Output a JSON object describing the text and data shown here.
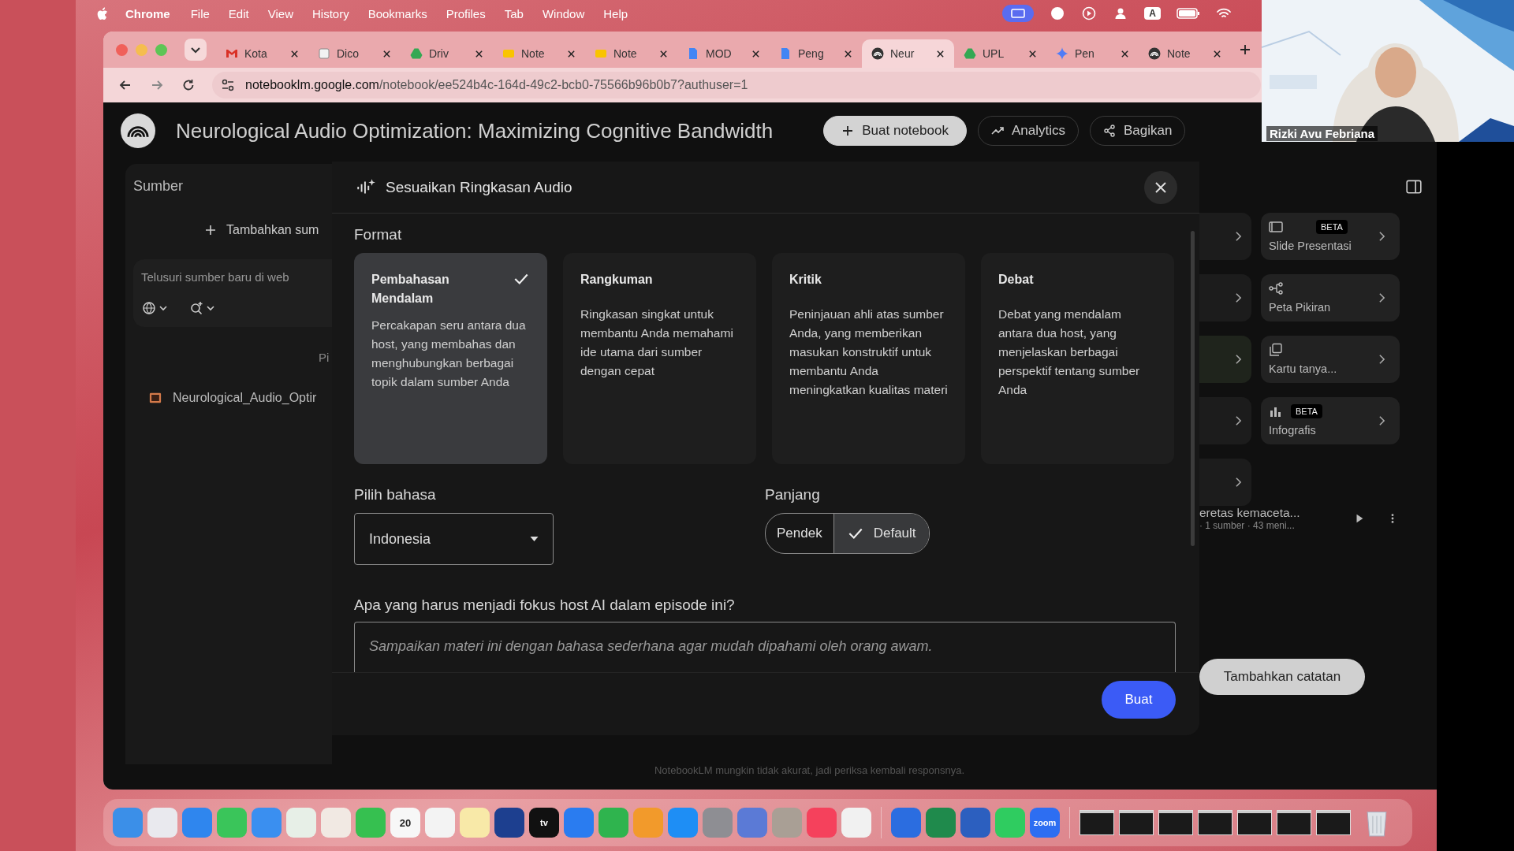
{
  "menu_bar": {
    "app": "Chrome",
    "menus": [
      "File",
      "Edit",
      "View",
      "History",
      "Bookmarks",
      "Profiles",
      "Tab",
      "Window",
      "Help"
    ],
    "input_source": "A"
  },
  "browser": {
    "tabs": [
      {
        "label": "Kota",
        "selected": false
      },
      {
        "label": "Dico",
        "selected": false
      },
      {
        "label": "Driv",
        "selected": false
      },
      {
        "label": "Note",
        "selected": false
      },
      {
        "label": "Note",
        "selected": false
      },
      {
        "label": "MOD",
        "selected": false
      },
      {
        "label": "Peng",
        "selected": false
      },
      {
        "label": "Neur",
        "selected": true
      },
      {
        "label": "UPL",
        "selected": false
      },
      {
        "label": "Pen",
        "selected": false
      },
      {
        "label": "Note",
        "selected": false
      }
    ],
    "url_host": "notebooklm.google.com",
    "url_path": "/notebook/ee524b4c-164d-49c2-bcb0-75566b96b0b7?authuser=1"
  },
  "notebook": {
    "title": "Neurological Audio Optimization: Maximizing Cognitive Bandwidth",
    "actions": [
      {
        "label": "Buat notebook",
        "kind": "create"
      },
      {
        "label": "Analytics",
        "kind": "analytics"
      },
      {
        "label": "Bagikan",
        "kind": "share"
      }
    ]
  },
  "sources": {
    "title": "Sumber",
    "add_label": "Tambahkan sum",
    "search_placeholder": "Telusuri sumber baru di web",
    "select_all": "Pi",
    "items": [
      {
        "name": "Neurological_Audio_Optir"
      }
    ]
  },
  "dialog": {
    "title": "Sesuaikan Ringkasan Audio",
    "format_label": "Format",
    "formats": [
      {
        "title": "Pembahasan Mendalam",
        "description": "Percakapan seru antara dua host, yang membahas dan menghubungkan berbagai topik dalam sumber Anda",
        "selected": true
      },
      {
        "title": "Rangkuman",
        "description": "Ringkasan singkat untuk membantu Anda memahami ide utama dari sumber dengan cepat",
        "selected": false
      },
      {
        "title": "Kritik",
        "description": "Peninjauan ahli atas sumber Anda, yang memberikan masukan konstruktif untuk membantu Anda meningkatkan kualitas materi",
        "selected": false
      },
      {
        "title": "Debat",
        "description": "Debat yang mendalam antara dua host, yang menjelaskan berbagai perspektif tentang sumber Anda",
        "selected": false
      }
    ],
    "language_label": "Pilih bahasa",
    "language": "Indonesia",
    "length_label": "Panjang",
    "lengths": [
      {
        "label": "Pendek",
        "selected": false
      },
      {
        "label": "Default",
        "selected": true
      }
    ],
    "focus_label": "Apa yang harus menjadi fokus host AI dalam episode ini?",
    "focus_placeholder": "Sampaikan materi ini dengan bahasa sederhana agar mudah dipahami oleh orang awam.",
    "submit": "Buat"
  },
  "studio": {
    "cards": [
      {
        "label": "Slide Presentasi",
        "badge": "BETA"
      },
      {
        "label": "Peta Pikiran"
      },
      {
        "label": "Kartu tanya..."
      },
      {
        "label": "Infografis",
        "badge": "BETA"
      }
    ],
    "audio_item": {
      "title": "eretas kemaceta...",
      "meta": "· 1 sumber · 43 meni..."
    },
    "add_note": "Tambahkan catatan"
  },
  "footer_note": "NotebookLM mungkin tidak akurat, jadi periksa kembali responsnya.",
  "dock": [
    {
      "kind": "app",
      "color": "#3b8fe8"
    },
    {
      "kind": "app",
      "color": "#e9e9ee"
    },
    {
      "kind": "app",
      "color": "#2f86ee"
    },
    {
      "kind": "app",
      "color": "#3ac55a"
    },
    {
      "kind": "app",
      "color": "#3a8ff0"
    },
    {
      "kind": "app",
      "color": "#e7efe7"
    },
    {
      "kind": "app",
      "color": "#f1e9e3"
    },
    {
      "kind": "app",
      "color": "#36c050"
    },
    {
      "kind": "app",
      "color": "#f7f7f7",
      "label": "20"
    },
    {
      "kind": "app",
      "color": "#f3f3f3"
    },
    {
      "kind": "app",
      "color": "#f8e9a8"
    },
    {
      "kind": "app",
      "color": "#1d3f8f"
    },
    {
      "kind": "app",
      "color": "#111111",
      "label": "tv"
    },
    {
      "kind": "app",
      "color": "#2a7cf0"
    },
    {
      "kind": "app",
      "color": "#2fb44e"
    },
    {
      "kind": "app",
      "color": "#f29a2b"
    },
    {
      "kind": "app",
      "color": "#1e8ef5"
    },
    {
      "kind": "app",
      "color": "#8e8e93"
    },
    {
      "kind": "app",
      "color": "#5b7ad6"
    },
    {
      "kind": "app",
      "color": "#a99f95"
    },
    {
      "kind": "app",
      "color": "#f5415c"
    },
    {
      "kind": "app",
      "color": "#f1f1f1"
    },
    {
      "kind": "separator"
    },
    {
      "kind": "app",
      "color": "#2b6de0"
    },
    {
      "kind": "app",
      "color": "#1f8a4c"
    },
    {
      "kind": "app",
      "color": "#2c5fbf"
    },
    {
      "kind": "app",
      "color": "#2fcc60"
    },
    {
      "kind": "app",
      "color": "#2d6ef2",
      "label": "zoom"
    },
    {
      "kind": "separator"
    },
    {
      "kind": "window"
    },
    {
      "kind": "window"
    },
    {
      "kind": "window"
    },
    {
      "kind": "window"
    },
    {
      "kind": "window"
    },
    {
      "kind": "window"
    },
    {
      "kind": "window"
    },
    {
      "kind": "trash"
    }
  ],
  "video": {
    "name": "Rizki Avu Febriana"
  }
}
